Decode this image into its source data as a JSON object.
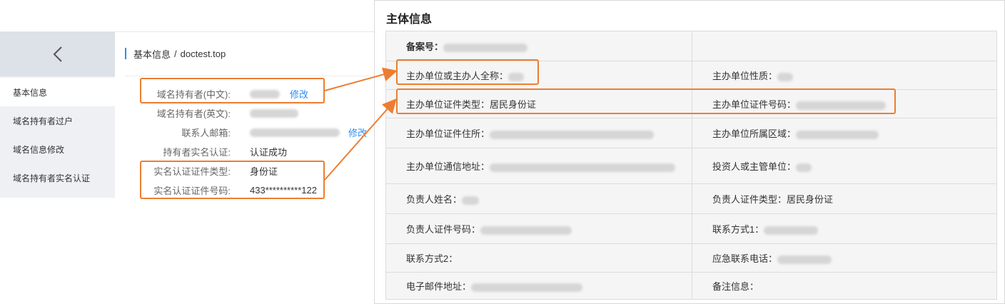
{
  "sidebar": {
    "items": [
      {
        "label": "基本信息",
        "active": true
      },
      {
        "label": "域名持有者过户",
        "active": false
      },
      {
        "label": "域名信息修改",
        "active": false
      },
      {
        "label": "域名持有者实名认证",
        "active": false
      }
    ]
  },
  "breadcrumb": {
    "section": "基本信息",
    "separator": "/",
    "domain": "doctest.top"
  },
  "domain_info": {
    "holder_cn_label": "域名持有者(中文):",
    "holder_en_label": "域名持有者(英文):",
    "email_label": "联系人邮箱:",
    "verify_label": "持有者实名认证:",
    "verify_value": "认证成功",
    "id_type_label": "实名认证证件类型:",
    "id_type_value": "身份证",
    "id_number_label": "实名认证证件号码:",
    "id_number_value": "433**********122",
    "edit_link": "修改"
  },
  "subject": {
    "title": "主体信息",
    "filing_no_label": "备案号：",
    "org_name_label": "主办单位或主办人全称：",
    "org_nature_label": "主办单位性质：",
    "org_id_type_label": "主办单位证件类型：",
    "org_id_type_value": "居民身份证",
    "org_id_number_label": "主办单位证件号码：",
    "org_id_address_label": "主办单位证件住所：",
    "org_region_label": "主办单位所属区域：",
    "org_mail_address_label": "主办单位通信地址：",
    "investor_label": "投资人或主管单位：",
    "leader_name_label": "负责人姓名：",
    "leader_id_type_label": "负责人证件类型：",
    "leader_id_type_value": "居民身份证",
    "leader_id_number_label": "负责人证件号码：",
    "contact1_label": "联系方式1：",
    "contact2_label": "联系方式2：",
    "emergency_phone_label": "应急联系电话：",
    "email_label": "电子邮件地址：",
    "remark_label": "备注信息："
  },
  "colors": {
    "highlight": "#ed7d31",
    "link": "#2d8cf0",
    "sidebar_bg": "#eef0f4"
  }
}
